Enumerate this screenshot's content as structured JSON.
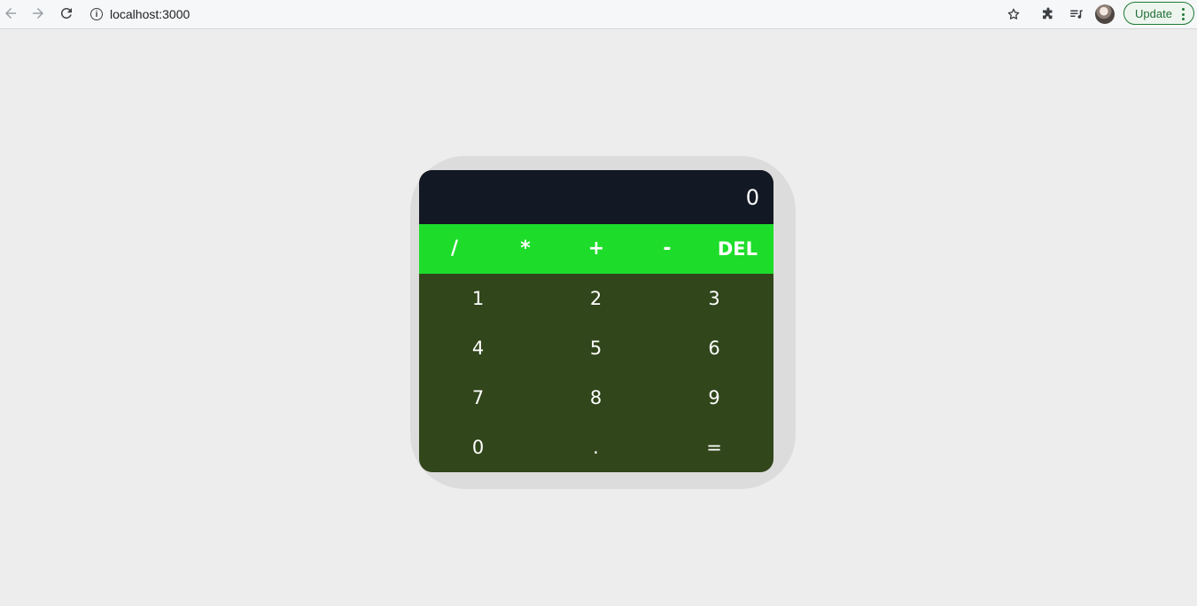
{
  "browser": {
    "url": "localhost:3000",
    "update_label": "Update",
    "icons": {
      "back": "back-arrow-icon",
      "forward": "forward-arrow-icon",
      "reload": "reload-icon",
      "info": "info-icon",
      "star": "star-icon",
      "extensions": "puzzle-icon",
      "media": "media-queue-icon",
      "menu": "kebab-menu-icon"
    }
  },
  "calculator": {
    "display": "0",
    "operators": [
      "/",
      "*",
      "+",
      "-",
      "DEL"
    ],
    "digits": [
      "1",
      "2",
      "3",
      "4",
      "5",
      "6",
      "7",
      "8",
      "9",
      "0",
      ".",
      "="
    ],
    "colors": {
      "display_bg": "#131924",
      "operator_bg": "#1ddd2a",
      "digits_bg": "#31461b",
      "page_bg": "#ededed"
    }
  }
}
